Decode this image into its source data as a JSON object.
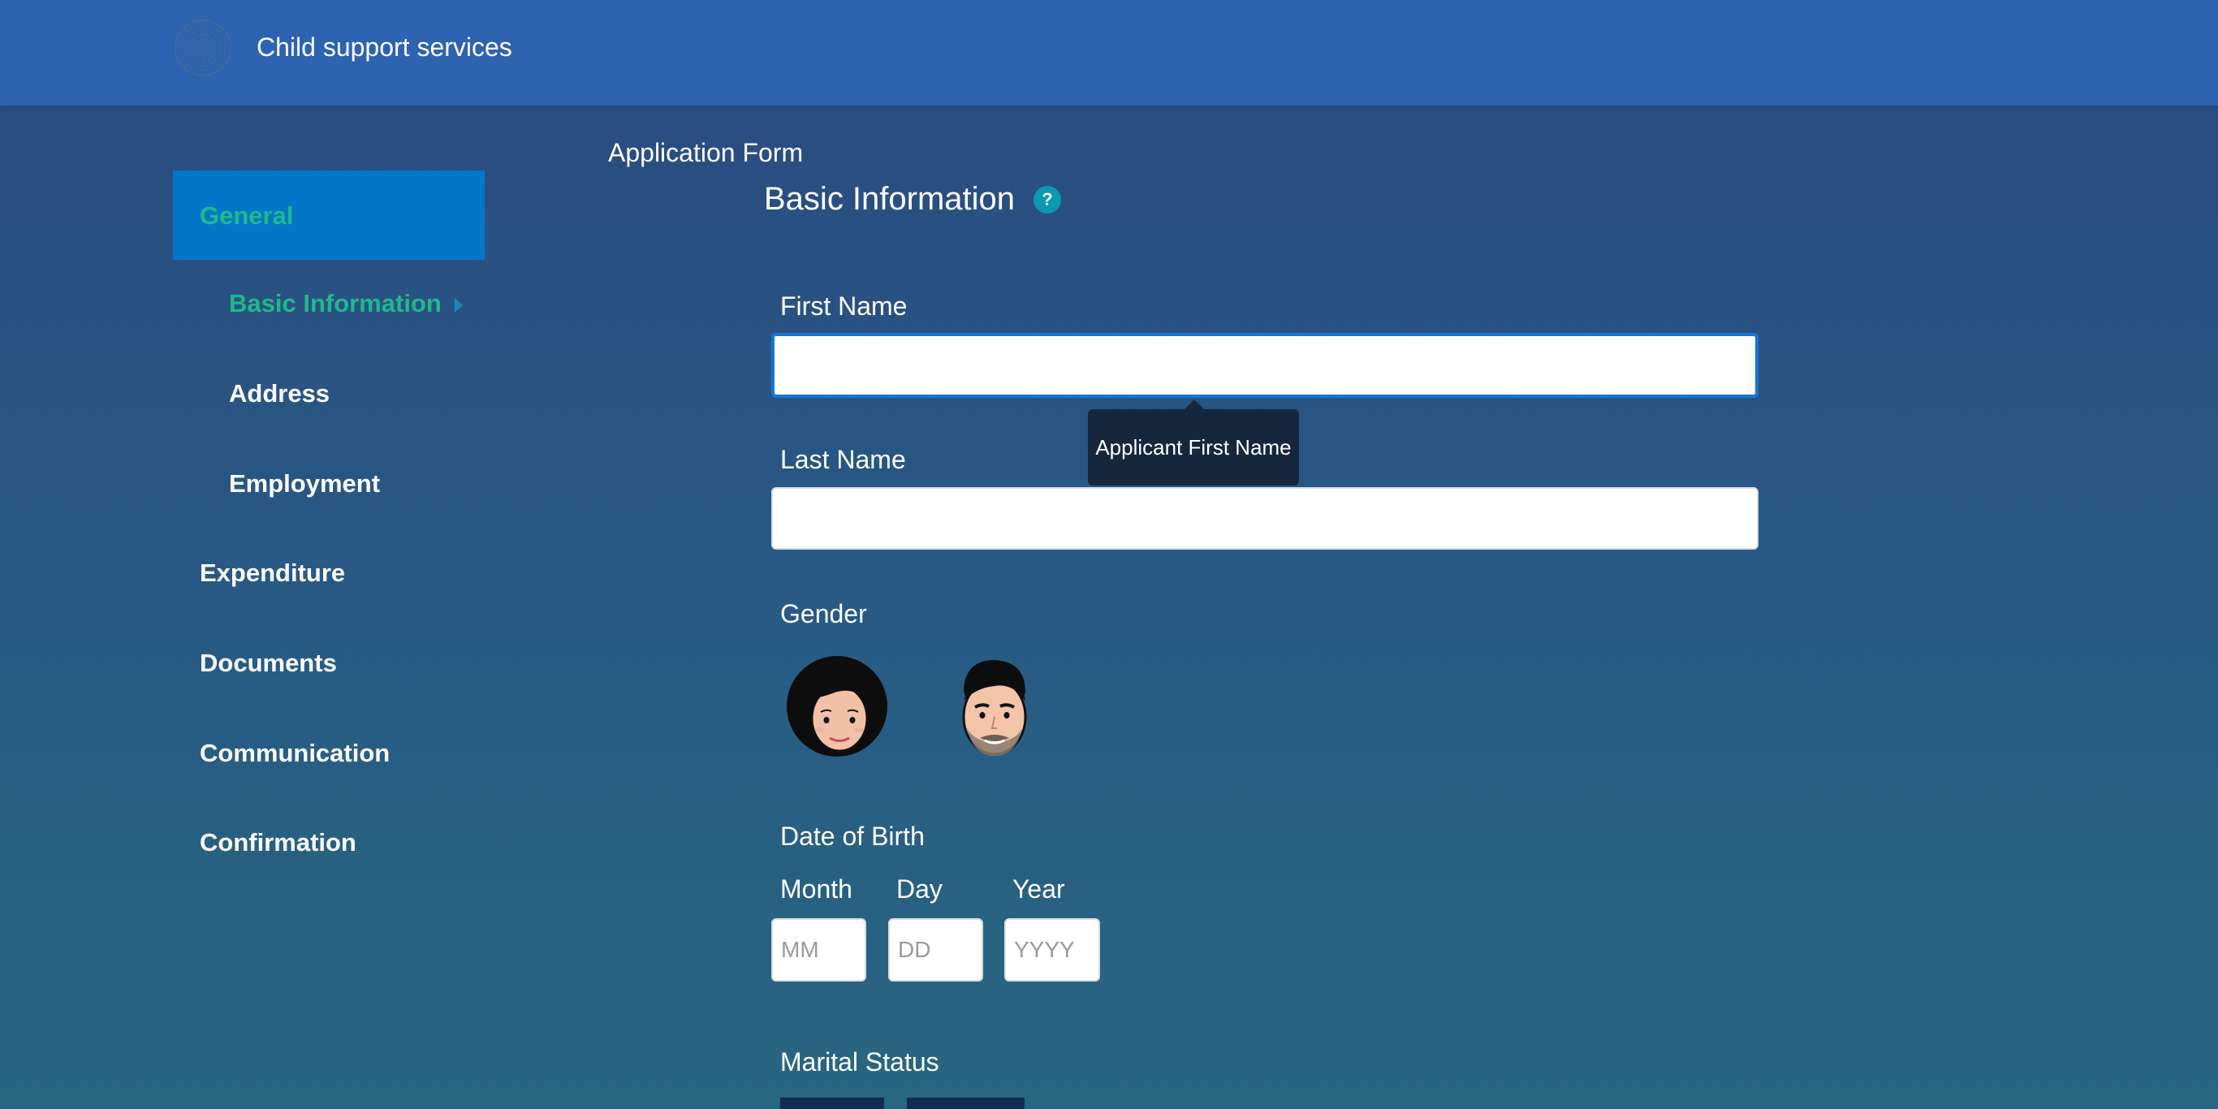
{
  "header": {
    "app_title": "Child support services",
    "logo_icon": "globe-dots-logo"
  },
  "sidebar": {
    "items": [
      {
        "label": "General",
        "active": true
      },
      {
        "label": "Basic Information",
        "active": true
      },
      {
        "label": "Address"
      },
      {
        "label": "Employment"
      },
      {
        "label": "Expenditure"
      },
      {
        "label": "Documents"
      },
      {
        "label": "Communication"
      },
      {
        "label": "Confirmation"
      }
    ]
  },
  "main": {
    "form_title": "Application Form",
    "section_title": "Basic Information",
    "help_icon_glyph": "?",
    "first_name": {
      "label": "First Name",
      "value": ""
    },
    "tooltip": "Applicant First Name",
    "last_name": {
      "label": "Last Name",
      "value": ""
    },
    "gender": {
      "label": "Gender",
      "options": [
        "female-avatar",
        "male-avatar"
      ]
    },
    "dob": {
      "label": "Date of Birth",
      "month_label": "Month",
      "day_label": "Day",
      "year_label": "Year",
      "month_placeholder": "MM",
      "day_placeholder": "DD",
      "year_placeholder": "YYYY"
    },
    "marital_status": {
      "label": "Marital Status"
    }
  },
  "colors": {
    "topbar": "#2d63b0",
    "active_item_bg": "#0277c8",
    "active_text": "#1fb98c",
    "input_focus_border": "#1677d8",
    "tooltip_bg": "#16263d"
  }
}
